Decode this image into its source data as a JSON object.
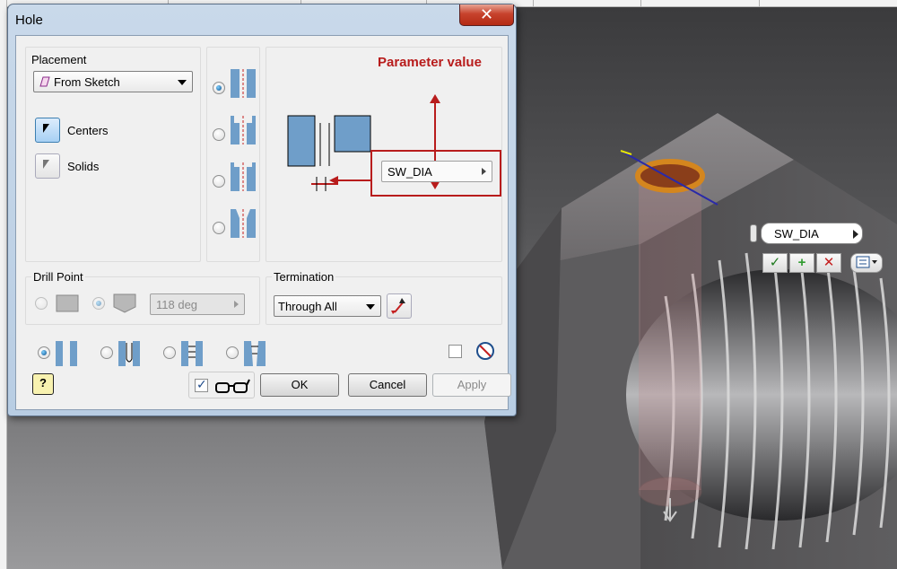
{
  "window": {
    "title": "Hole",
    "close_glyph": "✕"
  },
  "placement": {
    "label": "Placement",
    "dropdown_value": "From Sketch",
    "centers_label": "Centers",
    "solids_label": "Solids"
  },
  "hole_types": [
    "simple-drill",
    "counterbore",
    "spotface",
    "countersink"
  ],
  "annotation": {
    "label": "Parameter value",
    "parameter_value": "SW_DIA"
  },
  "drill_point": {
    "label": "Drill Point",
    "angle": "118 deg"
  },
  "termination": {
    "label": "Termination",
    "value": "Through All"
  },
  "buttons": {
    "ok": "OK",
    "cancel": "Cancel",
    "apply": "Apply",
    "help_glyph": "?"
  },
  "viewport_widget": {
    "field_value": "SW_DIA",
    "ok_glyph": "✓",
    "add_glyph": "+",
    "cancel_glyph": "✕"
  },
  "colors": {
    "annotation_red": "#b81c1c",
    "hole_blue": "#6f9ec9",
    "hole_ring": "#d4861e"
  }
}
